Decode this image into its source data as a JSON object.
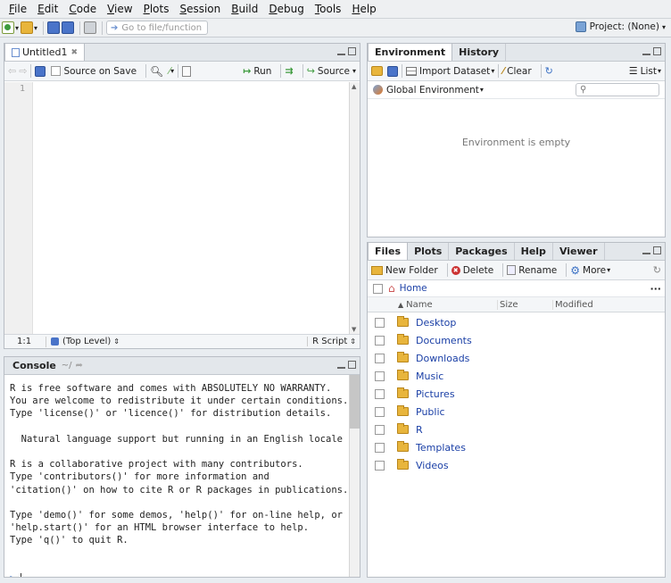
{
  "menubar": {
    "items": [
      {
        "u": "F",
        "rest": "ile"
      },
      {
        "u": "E",
        "rest": "dit"
      },
      {
        "u": "C",
        "rest": "ode"
      },
      {
        "u": "V",
        "rest": "iew"
      },
      {
        "u": "P",
        "rest": "lots"
      },
      {
        "u": "S",
        "rest": "ession"
      },
      {
        "u": "B",
        "rest": "uild"
      },
      {
        "u": "D",
        "rest": "ebug"
      },
      {
        "u": "T",
        "rest": "ools"
      },
      {
        "u": "H",
        "rest": "elp"
      }
    ]
  },
  "toolbar": {
    "goto_placeholder": "Go to file/function",
    "project": "Project: (None)"
  },
  "editor": {
    "tab": "Untitled1",
    "source_on_save": "Source on Save",
    "run": "Run",
    "source": "Source",
    "line_number": "1",
    "status_pos": "1:1",
    "status_scope": "(Top Level)",
    "status_type": "R Script"
  },
  "console": {
    "title": "Console",
    "path": "~/",
    "lines": [
      "R is free software and comes with ABSOLUTELY NO WARRANTY.",
      "You are welcome to redistribute it under certain conditions.",
      "Type 'license()' or 'licence()' for distribution details.",
      "",
      "  Natural language support but running in an English locale",
      "",
      "R is a collaborative project with many contributors.",
      "Type 'contributors()' for more information and",
      "'citation()' on how to cite R or R packages in publications.",
      "",
      "Type 'demo()' for some demos, 'help()' for on-line help, or",
      "'help.start()' for an HTML browser interface to help.",
      "Type 'q()' to quit R.",
      "",
      ""
    ],
    "prompt": ">"
  },
  "environment": {
    "tabs": [
      "Environment",
      "History"
    ],
    "import": "Import Dataset",
    "clear": "Clear",
    "list": "List",
    "scope": "Global Environment",
    "empty": "Environment is empty"
  },
  "files": {
    "tabs": [
      "Files",
      "Plots",
      "Packages",
      "Help",
      "Viewer"
    ],
    "new_folder": "New Folder",
    "delete": "Delete",
    "rename": "Rename",
    "more": "More",
    "home": "Home",
    "columns": {
      "name": "Name",
      "size": "Size",
      "modified": "Modified"
    },
    "items": [
      "Desktop",
      "Documents",
      "Downloads",
      "Music",
      "Pictures",
      "Public",
      "R",
      "Templates",
      "Videos"
    ]
  },
  "colors": {
    "accent": "#3a70c4",
    "folder": "#e8b53c",
    "link": "#1a3fa6"
  }
}
